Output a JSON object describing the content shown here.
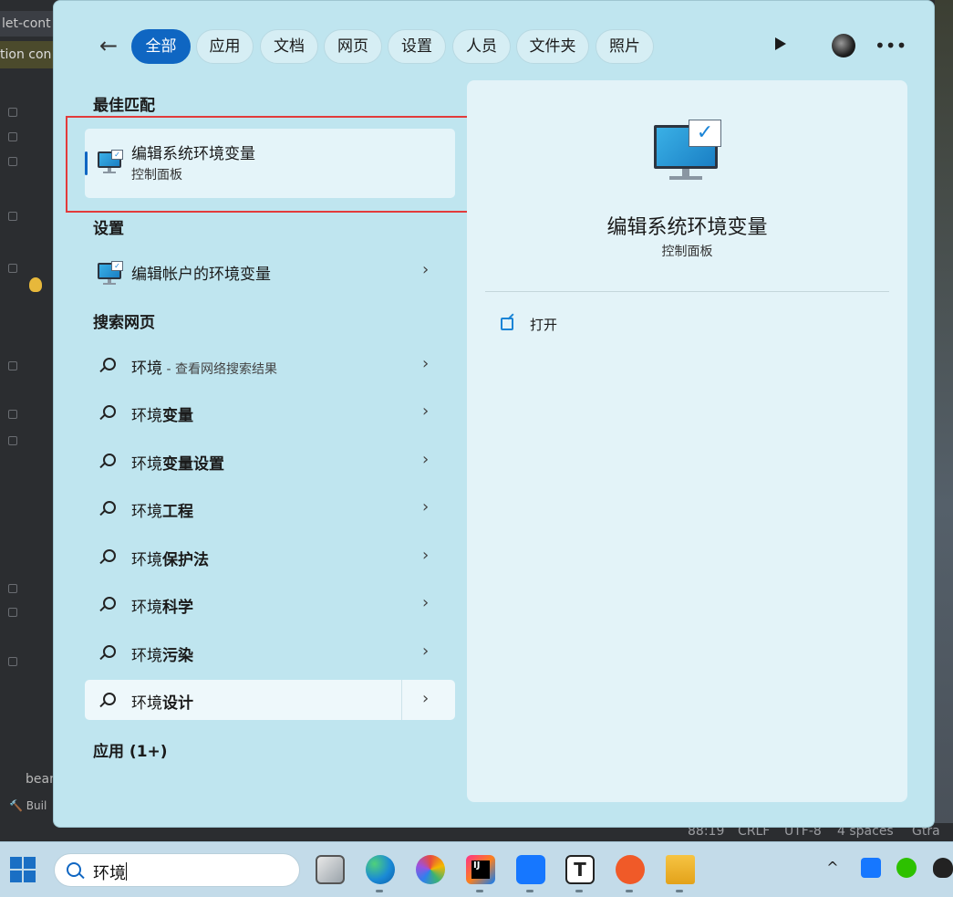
{
  "background": {
    "tab_label": "let-cont",
    "tab_label_2": "tion con",
    "footer_word": "bean",
    "build_label": "Buil",
    "status_bar": [
      "88:19",
      "CRLF",
      "UTF-8",
      "4 spaces",
      "Gtra"
    ]
  },
  "search_panel": {
    "filters": [
      "全部",
      "应用",
      "文档",
      "网页",
      "设置",
      "人员",
      "文件夹",
      "照片"
    ],
    "active_filter": "全部",
    "sections": {
      "best_match": "最佳匹配",
      "settings": "设置",
      "web": "搜索网页",
      "apps": "应用 (1+)"
    },
    "best_match_item": {
      "title": "编辑系统环境变量",
      "subtitle": "控制面板"
    },
    "settings_item": {
      "title": "编辑帐户的环境变量"
    },
    "web_results": [
      {
        "prefix": "环境",
        "bold": "",
        "hint": " - 查看网络搜索结果"
      },
      {
        "prefix": "环境",
        "bold": "变量",
        "hint": ""
      },
      {
        "prefix": "环境",
        "bold": "变量设置",
        "hint": ""
      },
      {
        "prefix": "环境",
        "bold": "工程",
        "hint": ""
      },
      {
        "prefix": "环境",
        "bold": "保护法",
        "hint": ""
      },
      {
        "prefix": "环境",
        "bold": "科学",
        "hint": ""
      },
      {
        "prefix": "环境",
        "bold": "污染",
        "hint": ""
      },
      {
        "prefix": "环境",
        "bold": "设计",
        "hint": ""
      }
    ],
    "detail": {
      "title": "编辑系统环境变量",
      "subtitle": "控制面板",
      "actions": [
        "打开"
      ]
    }
  },
  "taskbar": {
    "search_value": "环境",
    "app_icons": [
      "task-view-icon",
      "edge-icon",
      "colorful-app-icon",
      "intellij-idea-icon",
      "feishu-icon",
      "typora-icon",
      "pen-app-icon",
      "file-explorer-icon"
    ],
    "tray_icons": [
      "chevron-up-icon",
      "feishu-tray-icon",
      "wechat-icon",
      "qq-icon"
    ]
  },
  "colors": {
    "accent": "#0f66c2",
    "panel_bg": "#bfe5ef",
    "highlight_border": "#e23b3b"
  }
}
